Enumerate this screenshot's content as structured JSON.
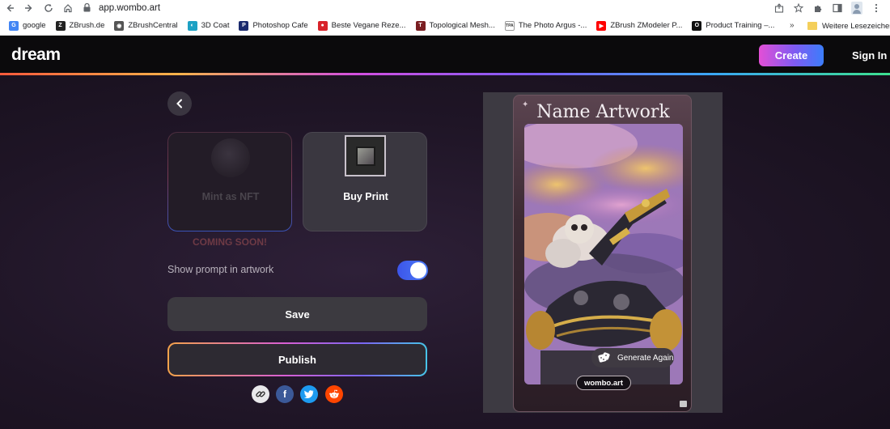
{
  "browser": {
    "url": "app.wombo.art",
    "bookmarks": [
      {
        "label": "google",
        "color": "#4285f4",
        "glyph": "G"
      },
      {
        "label": "ZBrush.de",
        "color": "#222222",
        "glyph": "Z"
      },
      {
        "label": "ZBrushCentral",
        "color": "#555555",
        "glyph": "◉"
      },
      {
        "label": "3D Coat",
        "color": "#1da1c4",
        "glyph": "◐"
      },
      {
        "label": "Photoshop Cafe",
        "color": "#1a2a6e",
        "glyph": "P"
      },
      {
        "label": "Beste Vegane Reze...",
        "color": "#d8232a",
        "glyph": "●"
      },
      {
        "label": "Topological Mesh...",
        "color": "#7a1e22",
        "glyph": "T"
      },
      {
        "label": "The Photo Argus -...",
        "color": "#ffffff",
        "glyph": "TPA"
      },
      {
        "label": "ZBrush ZModeler P...",
        "color": "#ff0000",
        "glyph": "▶"
      },
      {
        "label": "Product Training –...",
        "color": "#111111",
        "glyph": "O"
      }
    ],
    "more": "»",
    "other_bookmarks": "Weitere Lesezeichen"
  },
  "header": {
    "logo": "dream",
    "create_label": "Create",
    "signin_label": "Sign In"
  },
  "options": {
    "nft_label": "Mint as NFT",
    "coming_soon": "COMING SOON!",
    "print_label": "Buy Print",
    "toggle_label": "Show prompt in artwork",
    "toggle_on": true,
    "save_label": "Save",
    "publish_label": "Publish"
  },
  "share": {
    "facebook_glyph": "f"
  },
  "preview": {
    "title": "Name Artwork",
    "generate_again": "Generate Again",
    "watermark": "wombo.art"
  }
}
